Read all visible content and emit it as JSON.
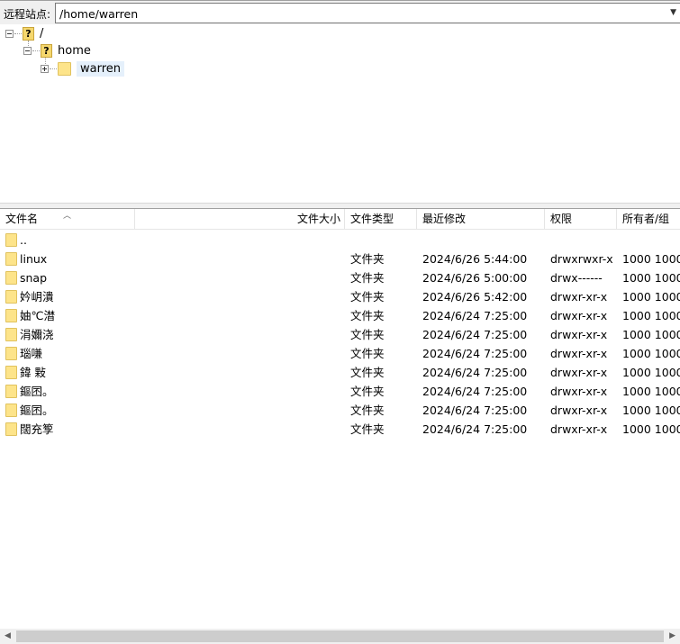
{
  "address": {
    "label": "远程站点:",
    "path": "/home/warren"
  },
  "tree": {
    "root": "/",
    "home": "home",
    "warren": "warren",
    "unknown_icon": "?"
  },
  "list": {
    "columns": [
      "文件名",
      "文件大小",
      "文件类型",
      "最近修改",
      "权限",
      "所有者/组"
    ],
    "parent_dir": "..",
    "rows": [
      {
        "name": "linux",
        "size": "",
        "type": "文件夹",
        "modified": "2024/6/26 5:44:00",
        "perm": "drwxrwxr-x",
        "owner": "1000 1000"
      },
      {
        "name": "snap",
        "size": "",
        "type": "文件夹",
        "modified": "2024/6/26 5:00:00",
        "perm": "drwx------",
        "owner": "1000 1000"
      },
      {
        "name": "妗岄潰",
        "size": "",
        "type": "文件夹",
        "modified": "2024/6/26 5:42:00",
        "perm": "drwxr-xr-x",
        "owner": "1000 1000"
      },
      {
        "name": "妯℃澘",
        "size": "",
        "type": "文件夹",
        "modified": "2024/6/24 7:25:00",
        "perm": "drwxr-xr-x",
        "owner": "1000 1000"
      },
      {
        "name": "涓嬭浇",
        "size": "",
        "type": "文件夹",
        "modified": "2024/6/24 7:25:00",
        "perm": "drwxr-xr-x",
        "owner": "1000 1000"
      },
      {
        "name": "瑙嗛",
        "size": "",
        "type": "文件夹",
        "modified": "2024/6/24 7:25:00",
        "perm": "drwxr-xr-x",
        "owner": "1000 1000"
      },
      {
        "name": "鍏   敤",
        "size": "",
        "type": "文件夹",
        "modified": "2024/6/24 7:25:00",
        "perm": "drwxr-xr-x",
        "owner": "1000 1000"
      },
      {
        "name": "鏂囨。",
        "size": "",
        "type": "文件夹",
        "modified": "2024/6/24 7:25:00",
        "perm": "drwxr-xr-x",
        "owner": "1000 1000"
      },
      {
        "name": "鏂囨。",
        "size": "",
        "type": "文件夹",
        "modified": "2024/6/24 7:25:00",
        "perm": "drwxr-xr-x",
        "owner": "1000 1000"
      },
      {
        "name": "闊充箰",
        "size": "",
        "type": "文件夹",
        "modified": "2024/6/24 7:25:00",
        "perm": "drwxr-xr-x",
        "owner": "1000 1000"
      }
    ]
  },
  "scrollbar": {
    "left_arrow": "◀",
    "right_arrow": "▶"
  }
}
